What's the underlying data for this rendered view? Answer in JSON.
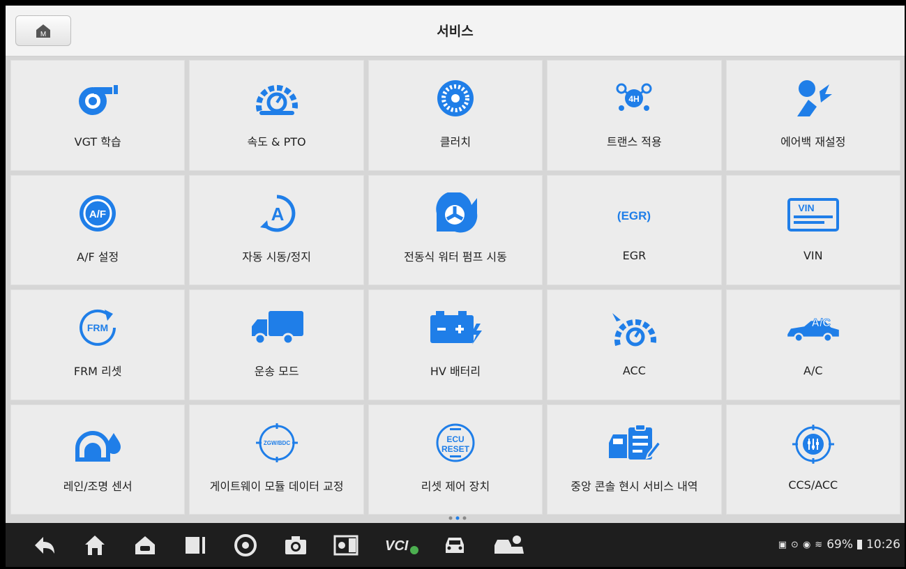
{
  "header": {
    "title": "서비스"
  },
  "tiles": [
    {
      "label": "VGT 학습",
      "icon": "turbo-icon"
    },
    {
      "label": "속도 & PTO",
      "icon": "speedometer-icon"
    },
    {
      "label": "클러치",
      "icon": "clutch-icon"
    },
    {
      "label": "트랜스 적용",
      "icon": "gear-shift-icon"
    },
    {
      "label": "에어백 재설정",
      "icon": "airbag-icon"
    },
    {
      "label": "A/F 설정",
      "icon": "af-icon"
    },
    {
      "label": "자동 시동/정지",
      "icon": "auto-start-stop-icon"
    },
    {
      "label": "전동식 워터 펌프 시동",
      "icon": "water-pump-icon"
    },
    {
      "label": "EGR",
      "icon": "egr-icon"
    },
    {
      "label": "VIN",
      "icon": "vin-icon"
    },
    {
      "label": "FRM 리셋",
      "icon": "frm-icon"
    },
    {
      "label": "운송 모드",
      "icon": "truck-icon"
    },
    {
      "label": "HV 배터리",
      "icon": "battery-icon"
    },
    {
      "label": "ACC",
      "icon": "acc-icon"
    },
    {
      "label": "A/C",
      "icon": "ac-car-icon"
    },
    {
      "label": "레인/조명 센서",
      "icon": "rain-light-sensor-icon"
    },
    {
      "label": "게이트웨이 모듈 데이터 교정",
      "icon": "gateway-icon"
    },
    {
      "label": "리셋 제어 장치",
      "icon": "ecu-reset-icon"
    },
    {
      "label": "중앙 콘솔 현시 서비스 내역",
      "icon": "service-record-icon"
    },
    {
      "label": "CCS/ACC",
      "icon": "ccs-icon"
    }
  ],
  "icon_text": {
    "af": "A/F",
    "egr": "(EGR)",
    "vin": "VIN",
    "frm": "FRM",
    "ac": "A/C",
    "gateway": "ZGW/BDC",
    "ecu1": "ECU",
    "ecu2": "RESET",
    "home": "M",
    "vci": "VCI"
  },
  "status": {
    "battery": "69%",
    "time": "10:26"
  },
  "colors": {
    "accent": "#1f7ee8",
    "background": "#d6d6d6",
    "tile": "#ececec",
    "navbar": "#1e1e1e"
  }
}
